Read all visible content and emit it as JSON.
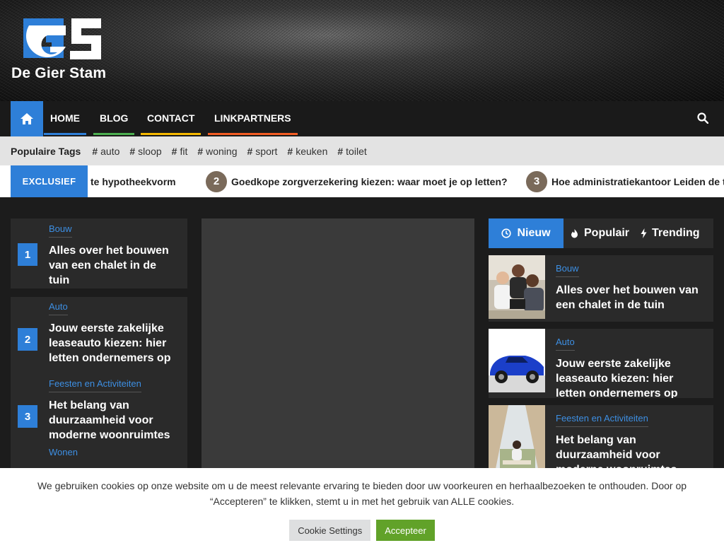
{
  "brand": {
    "name": "De Gier Stam",
    "accent": "#2e7fd8"
  },
  "nav": {
    "items": [
      {
        "label": "HOME",
        "color": "#2e7fd8"
      },
      {
        "label": "BLOG",
        "color": "#4caf50"
      },
      {
        "label": "CONTACT",
        "color": "#f5b800"
      },
      {
        "label": "LINKPARTNERS",
        "color": "#f25c23"
      }
    ]
  },
  "tags": {
    "title": "Populaire Tags",
    "items": [
      "auto",
      "sloop",
      "fit",
      "woning",
      "sport",
      "keuken",
      "toilet"
    ]
  },
  "ticker": {
    "label": "EXCLUSIEF",
    "items": [
      {
        "num": "",
        "text": "te hypotheekvorm"
      },
      {
        "num": "2",
        "text": "Goedkope zorgverzekering kiezen: waar moet je op letten?"
      },
      {
        "num": "3",
        "text": "Hoe administratiekantoor Leiden de t"
      }
    ]
  },
  "left_posts": [
    {
      "rank": "1",
      "category": "Bouw",
      "title": "Alles over het bouwen van een chalet in de tuin"
    },
    {
      "rank": "2",
      "category": "Auto",
      "title": "Jouw eerste zakelijke leaseauto kiezen: hier letten ondernemers op"
    },
    {
      "rank": "3",
      "category": "Feesten en Activiteiten",
      "title": "Het belang van duurzaamheid voor moderne woonruimtes"
    },
    {
      "rank": "",
      "category": "Wonen",
      "title": ""
    }
  ],
  "right_tabs": [
    "Nieuw",
    "Populair",
    "Trending"
  ],
  "right_posts": [
    {
      "category": "Bouw",
      "title": "Alles over het bouwen van een chalet in de tuin"
    },
    {
      "category": "Auto",
      "title": "Jouw eerste zakelijke leaseauto kiezen: hier letten ondernemers op"
    },
    {
      "category": "Feesten en Activiteiten",
      "title": "Het belang van duurzaamheid voor moderne woonruimtes"
    }
  ],
  "cookie": {
    "text": "We gebruiken cookies op onze website om u de meest relevante ervaring te bieden door uw voorkeuren en herhaalbezoeken te onthouden. Door op “Accepteren” te klikken, stemt u in met het gebruik van ALLE cookies.",
    "settings_label": "Cookie Settings",
    "accept_label": "Accepteer"
  }
}
